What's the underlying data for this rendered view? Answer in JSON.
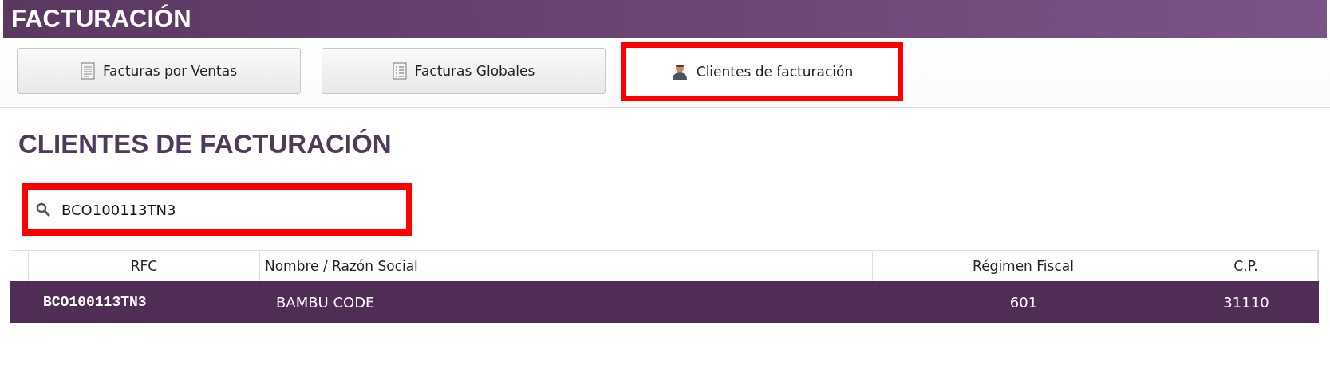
{
  "header": {
    "title": "FACTURACIÓN"
  },
  "tabs": [
    {
      "label": "Facturas por Ventas",
      "kind": "document",
      "selected": false,
      "highlighted": false
    },
    {
      "label": "Facturas Globales",
      "kind": "list",
      "selected": false,
      "highlighted": false
    },
    {
      "label": "Clientes de facturación",
      "kind": "person",
      "selected": true,
      "highlighted": true
    }
  ],
  "section_title": "CLIENTES DE FACTURACIÓN",
  "search": {
    "value": "BCO100113TN3",
    "highlighted": true
  },
  "table": {
    "columns": [
      "RFC",
      "Nombre / Razón Social",
      "Régimen Fiscal",
      "C.P."
    ],
    "rows": [
      {
        "selected": true,
        "cells": [
          "BCO100113TN3",
          "BAMBU CODE",
          "601",
          "31110"
        ]
      }
    ]
  }
}
